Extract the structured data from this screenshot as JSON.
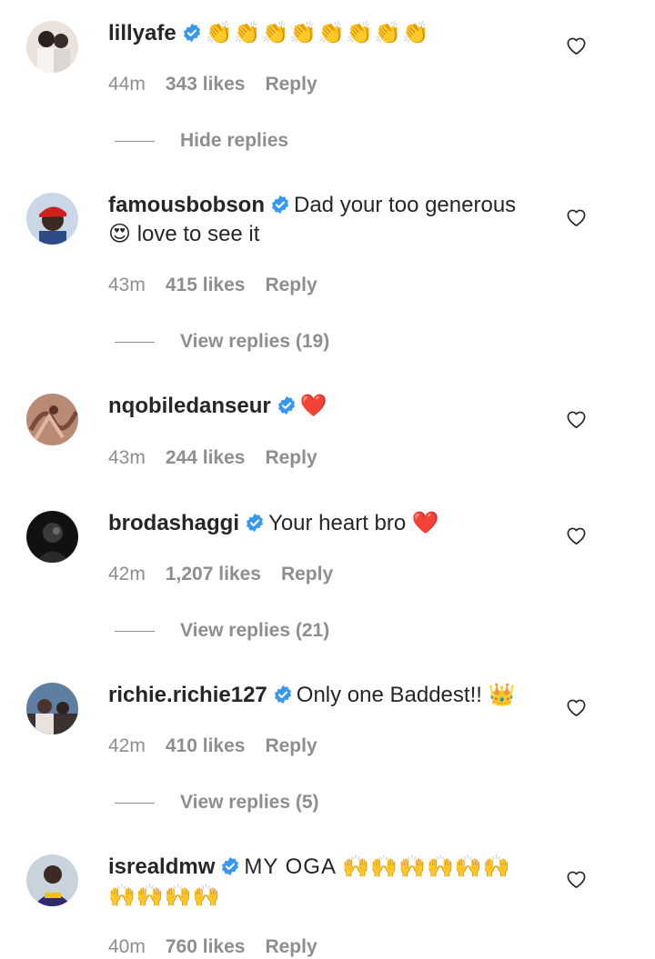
{
  "comments": [
    {
      "username": "lillyafe",
      "text": "👏👏👏👏👏👏👏👏",
      "time": "44m",
      "likes": "343 likes",
      "reply": "Reply",
      "replies_toggle": "Hide replies",
      "avatar_colors": [
        "#e9dcd6",
        "#f4f1ef",
        "#2b2220"
      ]
    },
    {
      "username": "famousbobson",
      "text": "Dad your too generous",
      "text_line2": "😍 love to see it",
      "time": "43m",
      "likes": "415 likes",
      "reply": "Reply",
      "replies_toggle": "View replies (19)",
      "avatar_colors": [
        "#c7d6e6",
        "#d0211f",
        "#3b2a22"
      ]
    },
    {
      "username": "nqobiledanseur",
      "text": "❤️",
      "time": "43m",
      "likes": "244 likes",
      "reply": "Reply",
      "avatar_colors": [
        "#b98a74",
        "#7a4a3a",
        "#e0b9a3"
      ]
    },
    {
      "username": "brodashaggi",
      "text": "Your heart bro ❤️",
      "time": "42m",
      "likes": "1,207 likes",
      "reply": "Reply",
      "replies_toggle": "View replies (21)",
      "avatar_colors": [
        "#111111",
        "#3a3a3a",
        "#6a6a6a"
      ]
    },
    {
      "username": "richie.richie127",
      "text": "Only one Baddest!! 👑",
      "time": "42m",
      "likes": "410 likes",
      "reply": "Reply",
      "replies_toggle": "View replies (5)",
      "avatar_colors": [
        "#5f7ea3",
        "#e8e3dc",
        "#3b3130"
      ]
    },
    {
      "username": "isrealdmw",
      "text": "MY OGA 🙌🙌🙌🙌🙌🙌",
      "text_line2": "🙌🙌🙌🙌",
      "time": "40m",
      "likes": "760 likes",
      "reply": "Reply",
      "avatar_colors": [
        "#c9d3dd",
        "#2f2a6b",
        "#3c2b22"
      ]
    }
  ],
  "colors": {
    "text": "#262626",
    "muted": "#8e8e8e",
    "verified_badge": "#3897f0"
  },
  "icons": {
    "verified": "verified-badge-icon",
    "like": "heart-outline-icon"
  }
}
